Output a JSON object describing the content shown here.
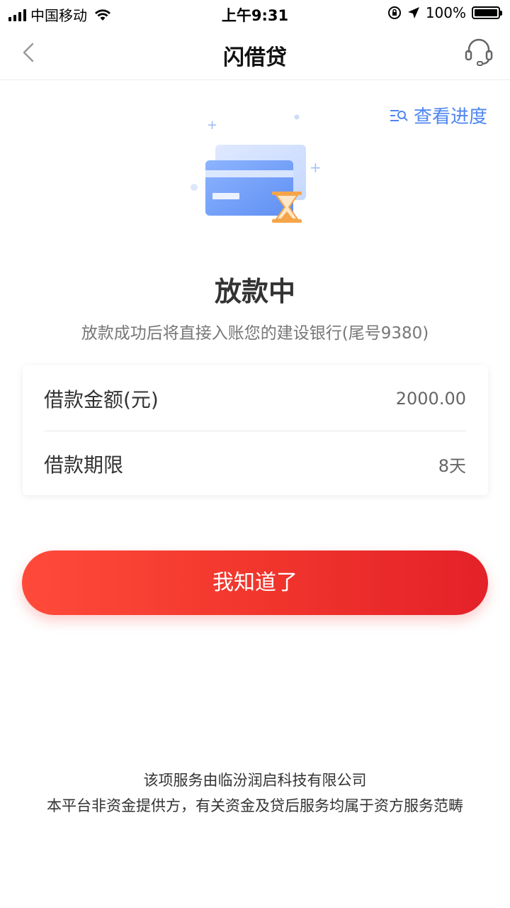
{
  "status_bar": {
    "carrier": "中国移动",
    "time": "上午9:31",
    "battery": "100%"
  },
  "nav": {
    "title": "闪借贷"
  },
  "progress_link": "查看进度",
  "status": {
    "title": "放款中",
    "description": "放款成功后将直接入账您的建设银行(尾号9380)"
  },
  "loan_info": {
    "amount_label": "借款金额(元)",
    "amount_value": "2000.00",
    "term_label": "借款期限",
    "term_value": "8天"
  },
  "confirm_button": "我知道了",
  "footer": {
    "line1": "该项服务由临汾润启科技有限公司",
    "line2": "本平台非资金提供方，有关资金及贷后服务均属于资方服务范畴"
  },
  "colors": {
    "accent_blue": "#4f86f0",
    "button_red": "#f0342c",
    "hourglass_orange": "#f4a54a"
  }
}
